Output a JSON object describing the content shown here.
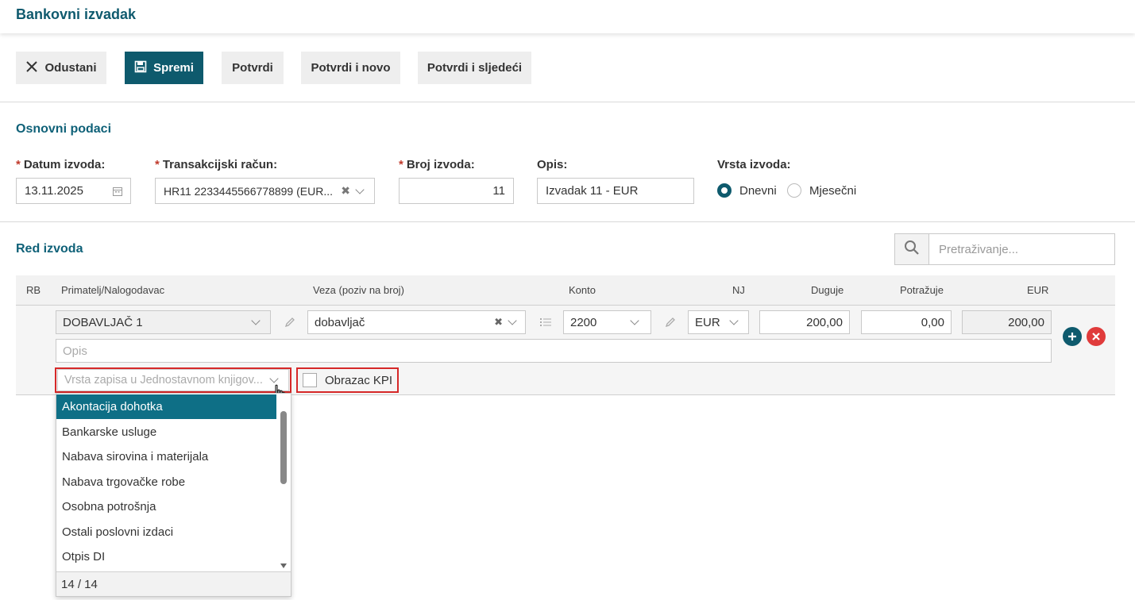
{
  "page": {
    "title": "Bankovni izvadak"
  },
  "toolbar": {
    "cancel_label": "Odustani",
    "save_label": "Spremi",
    "confirm_label": "Potvrdi",
    "confirm_new_label": "Potvrdi i novo",
    "confirm_next_label": "Potvrdi i sljedeći"
  },
  "basic": {
    "section_title": "Osnovni podaci",
    "date_label": "Datum izvoda:",
    "date_value": "13.11.2025",
    "account_label": "Transakcijski račun:",
    "account_value": "HR11 2233445566778899 (EUR...",
    "number_label": "Broj izvoda:",
    "number_value": "11",
    "desc_label": "Opis:",
    "desc_value": "Izvadak 11 - EUR",
    "type_label": "Vrsta izvoda:",
    "type_options": [
      "Dnevni",
      "Mjesečni"
    ],
    "type_selected": "Dnevni",
    "required_mark": "*"
  },
  "lines": {
    "section_title": "Red izvoda",
    "search_placeholder": "Pretraživanje...",
    "columns": [
      "RB",
      "Primatelj/Nalogodavac",
      "Veza (poziv na broj)",
      "Konto",
      "NJ",
      "Duguje",
      "Potražuje",
      "EUR"
    ],
    "row": {
      "partner": "DOBAVLJAČ 1",
      "reference": "dobavljač",
      "account": "2200",
      "currency": "EUR",
      "debit": "200,00",
      "credit": "0,00",
      "amount_eur": "200,00",
      "desc_placeholder": "Opis",
      "record_type_placeholder": "Vrsta zapisa u Jednostavnom knjigov...",
      "kpi_label": "Obrazac KPI",
      "kpi_checked": false
    }
  },
  "dropdown": {
    "items": [
      "Akontacija dohotka",
      "Bankarske usluge",
      "Nabava sirovina i materijala",
      "Nabava trgovačke robe",
      "Osobna potrošnja",
      "Ostali poslovni izdaci",
      "Otpis DI"
    ],
    "selected_index": 0,
    "count_text": "14 / 14"
  },
  "colors": {
    "primary": "#0e5a6d",
    "section_title": "#0f6178",
    "required": "#c0392b",
    "highlight_border": "#d62828",
    "add_button": "#0e5a6d",
    "remove_button": "#e03b3b",
    "selected_item": "#0e6f86"
  }
}
